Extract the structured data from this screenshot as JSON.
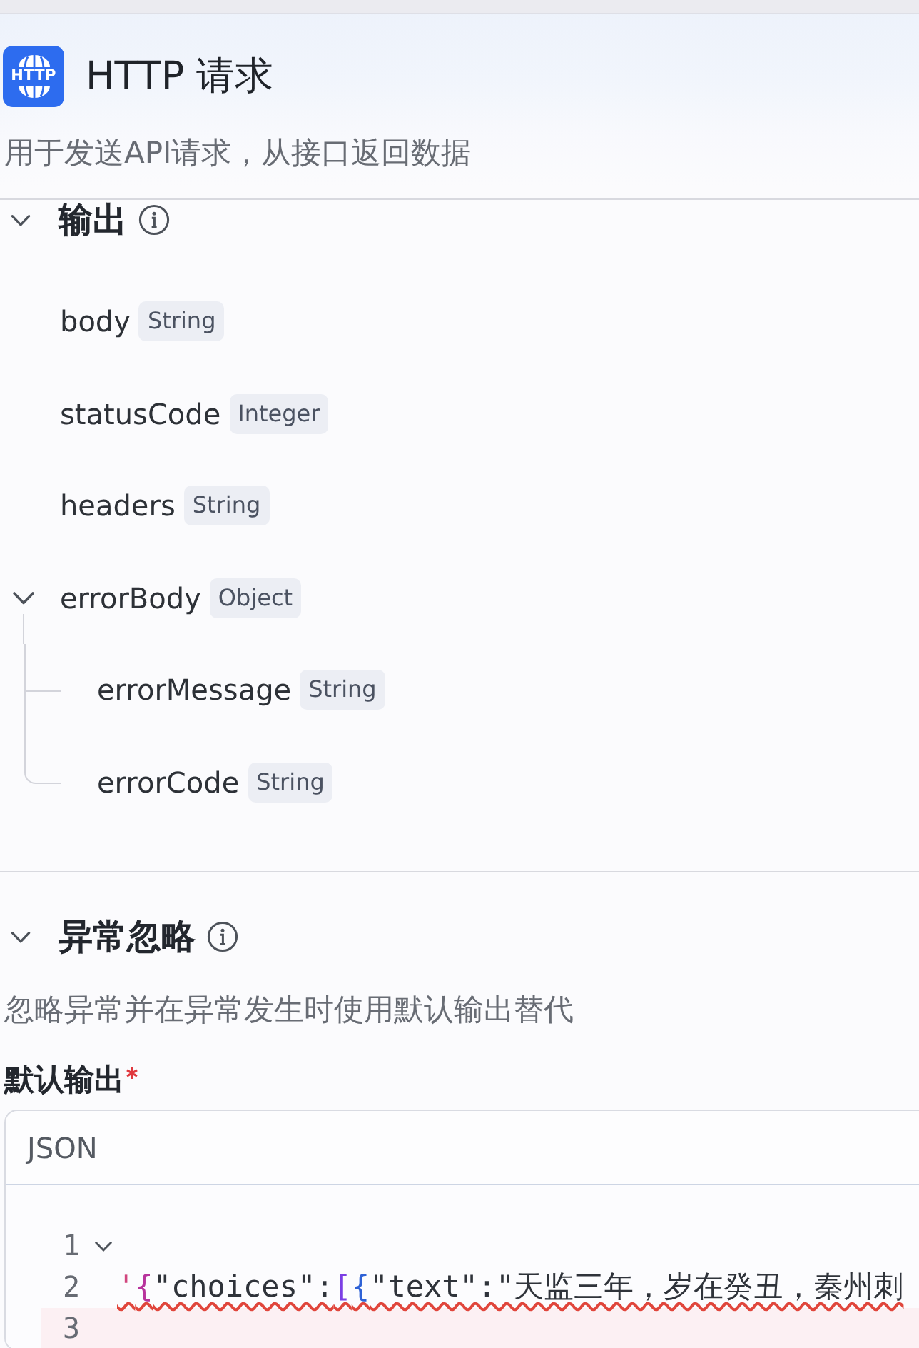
{
  "header": {
    "logo_text": "HTTP",
    "title": "HTTP 请求",
    "description": "用于发送API请求，从接口返回数据"
  },
  "output_section": {
    "title": "输出",
    "expanded": true,
    "fields": [
      {
        "name": "body",
        "type": "String"
      },
      {
        "name": "statusCode",
        "type": "Integer"
      },
      {
        "name": "headers",
        "type": "String"
      },
      {
        "name": "errorBody",
        "type": "Object",
        "expanded": true,
        "children": [
          {
            "name": "errorMessage",
            "type": "String"
          },
          {
            "name": "errorCode",
            "type": "String"
          }
        ]
      }
    ]
  },
  "exception_section": {
    "title": "异常忽略",
    "expanded": true,
    "description": "忽略异常并在异常发生时使用默认输出替代",
    "default_output": {
      "label": "默认输出",
      "required": true,
      "editor": {
        "language": "JSON",
        "lines": [
          {
            "number": "1",
            "expanded": true,
            "active": false
          },
          {
            "number": "2",
            "text": "'{\"choices\":[{\"text\":\"天监三年，岁在癸丑，秦州刺",
            "error": true,
            "active": false
          },
          {
            "number": "3",
            "active": true
          }
        ]
      }
    }
  }
}
